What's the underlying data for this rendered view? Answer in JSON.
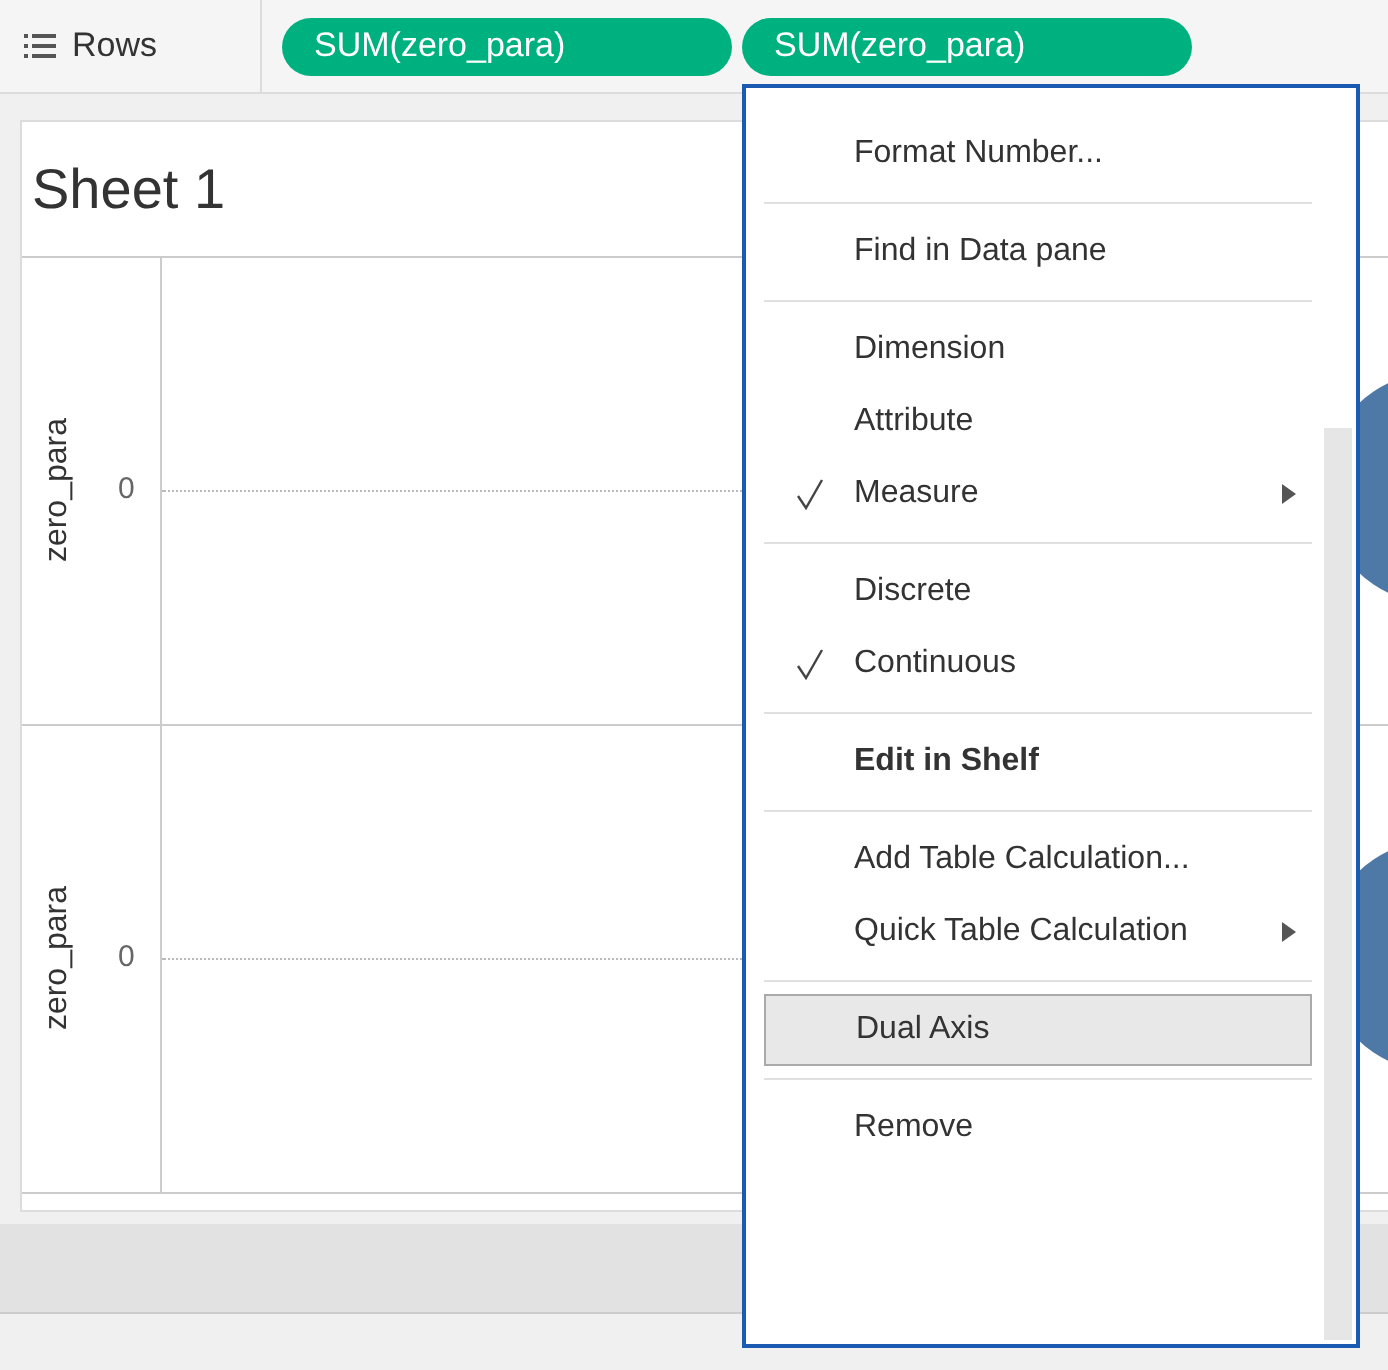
{
  "shelf": {
    "label": "Rows",
    "pills": [
      {
        "text": "SUM(zero_para)"
      },
      {
        "text": "SUM(zero_para)"
      }
    ]
  },
  "sheet": {
    "title": "Sheet 1",
    "panes": [
      {
        "axis_title": "zero_para",
        "tick": "0"
      },
      {
        "axis_title": "zero_para",
        "tick": "0"
      }
    ]
  },
  "context_menu": {
    "groups": [
      [
        {
          "label": "Format Number...",
          "checked": false,
          "bold": false,
          "submenu": false,
          "highlighted": false
        }
      ],
      [
        {
          "label": "Find in Data pane",
          "checked": false,
          "bold": false,
          "submenu": false,
          "highlighted": false
        }
      ],
      [
        {
          "label": "Dimension",
          "checked": false,
          "bold": false,
          "submenu": false,
          "highlighted": false
        },
        {
          "label": "Attribute",
          "checked": false,
          "bold": false,
          "submenu": false,
          "highlighted": false
        },
        {
          "label": "Measure",
          "checked": true,
          "bold": false,
          "submenu": true,
          "highlighted": false
        }
      ],
      [
        {
          "label": "Discrete",
          "checked": false,
          "bold": false,
          "submenu": false,
          "highlighted": false
        },
        {
          "label": "Continuous",
          "checked": true,
          "bold": false,
          "submenu": false,
          "highlighted": false
        }
      ],
      [
        {
          "label": "Edit in Shelf",
          "checked": false,
          "bold": true,
          "submenu": false,
          "highlighted": false
        }
      ],
      [
        {
          "label": "Add Table Calculation...",
          "checked": false,
          "bold": false,
          "submenu": false,
          "highlighted": false
        },
        {
          "label": "Quick Table Calculation",
          "checked": false,
          "bold": false,
          "submenu": true,
          "highlighted": false
        }
      ],
      [
        {
          "label": "Dual Axis",
          "checked": false,
          "bold": false,
          "submenu": false,
          "highlighted": true
        }
      ],
      [
        {
          "label": "Remove",
          "checked": false,
          "bold": false,
          "submenu": false,
          "highlighted": false
        }
      ]
    ]
  }
}
